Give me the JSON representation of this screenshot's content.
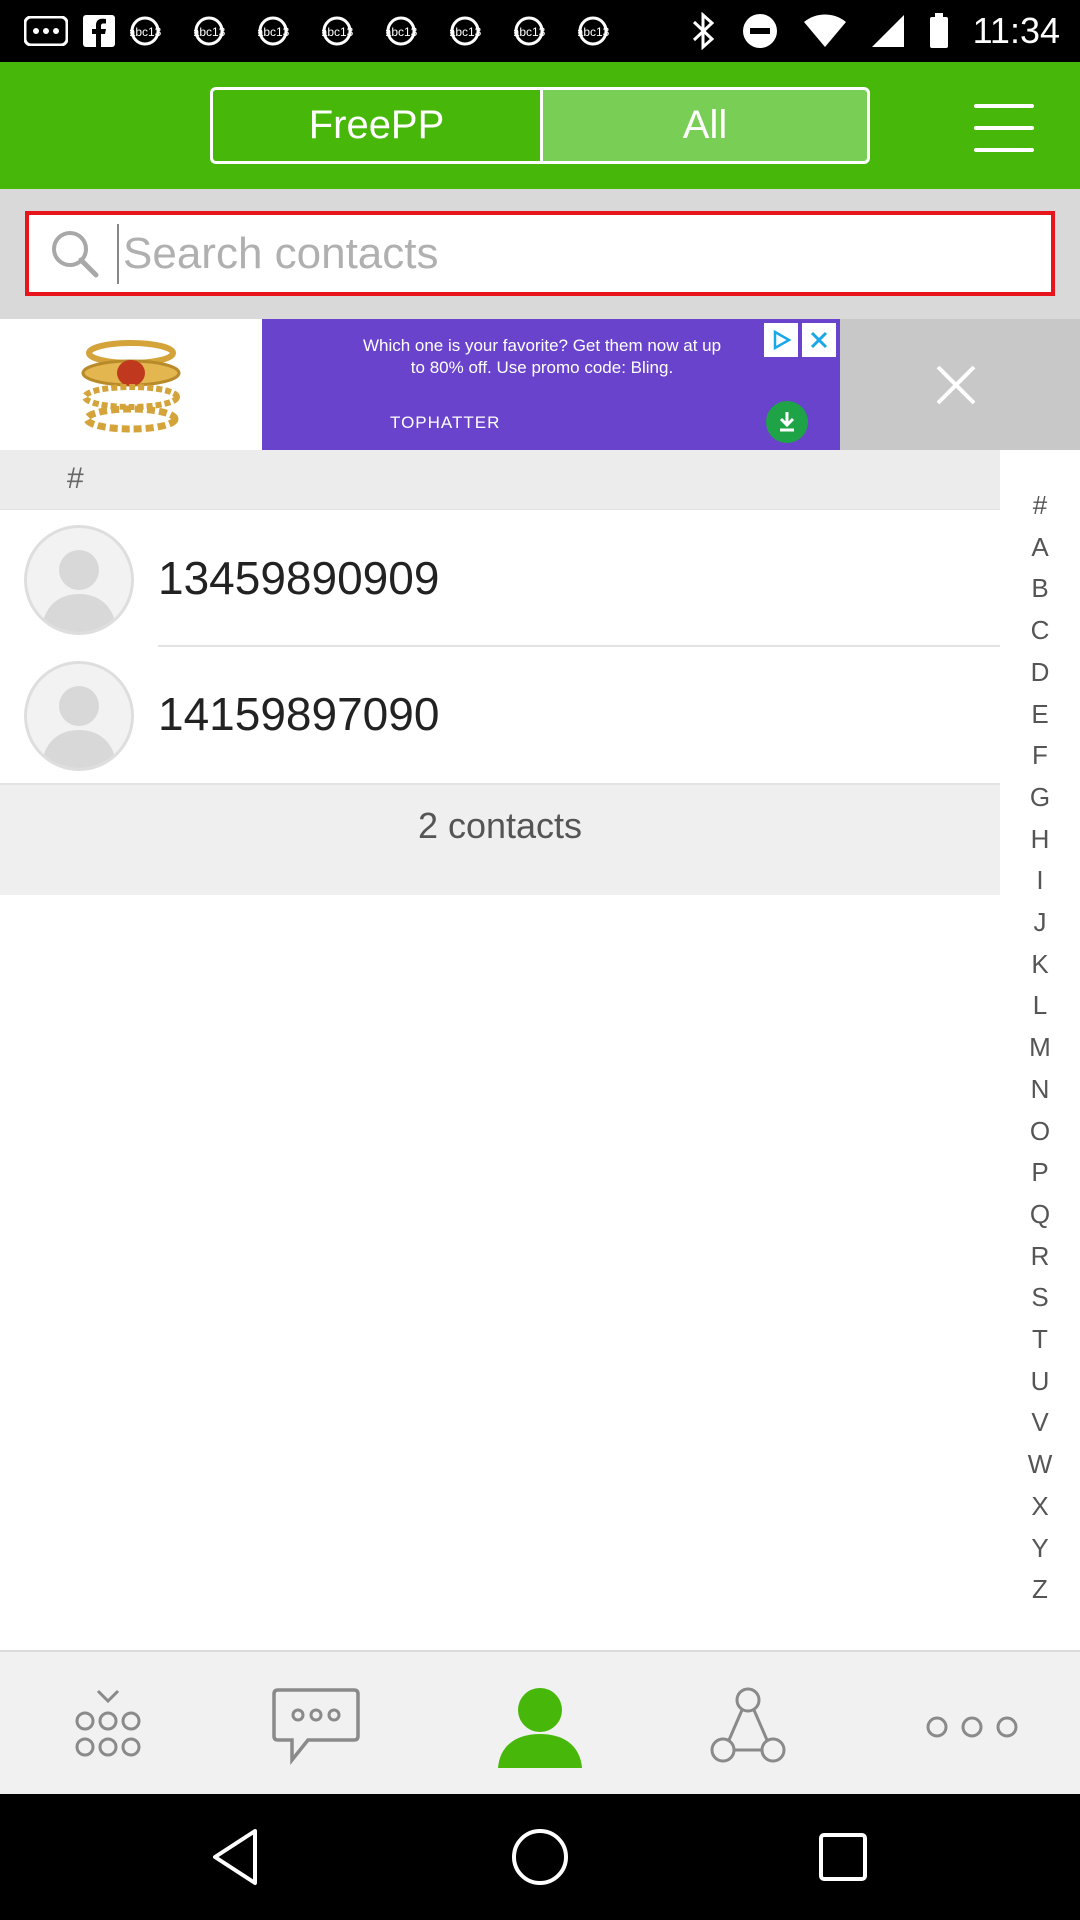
{
  "status_bar": {
    "time": "11:34",
    "notification_icons": [
      "more-dots-icon",
      "facebook-icon",
      "abc13-icon",
      "abc13-icon",
      "abc13-icon",
      "abc13-icon",
      "abc13-icon",
      "abc13-icon",
      "abc13-icon",
      "abc13-icon"
    ],
    "notification_labels": [
      "abc13",
      "abc13",
      "abc13",
      "abc13",
      "abc13",
      "abc13",
      "abc13",
      "abc13"
    ],
    "system_icons": [
      "bluetooth-icon",
      "do-not-disturb-icon",
      "wifi-icon",
      "signal-icon",
      "battery-icon"
    ]
  },
  "header": {
    "tabs": [
      {
        "label": "FreePP",
        "selected": false
      },
      {
        "label": "All",
        "selected": true
      }
    ],
    "menu_icon": "hamburger-menu-icon",
    "accent_color": "#47b80a"
  },
  "search": {
    "placeholder": "Search contacts",
    "value": ""
  },
  "ad": {
    "text": "Which one is your favorite? Get them now at up to 80% off. Use promo code: Bling.",
    "brand": "TOPHATTER",
    "close_icon": "close-icon"
  },
  "contacts": {
    "section_header": "#",
    "items": [
      {
        "name": "13459890909"
      },
      {
        "name": "14159897090"
      }
    ],
    "count_label": "2 contacts"
  },
  "alphabet_index": [
    "#",
    "A",
    "B",
    "C",
    "D",
    "E",
    "F",
    "G",
    "H",
    "I",
    "J",
    "K",
    "L",
    "M",
    "N",
    "O",
    "P",
    "Q",
    "R",
    "S",
    "T",
    "U",
    "V",
    "W",
    "X",
    "Y",
    "Z"
  ],
  "bottom_nav": [
    {
      "icon": "dialpad-icon",
      "active": false
    },
    {
      "icon": "chat-icon",
      "active": false
    },
    {
      "icon": "contacts-icon",
      "active": true
    },
    {
      "icon": "social-network-icon",
      "active": false
    },
    {
      "icon": "more-icon",
      "active": false
    }
  ],
  "system_nav": [
    "back-icon",
    "home-icon",
    "recents-icon"
  ]
}
